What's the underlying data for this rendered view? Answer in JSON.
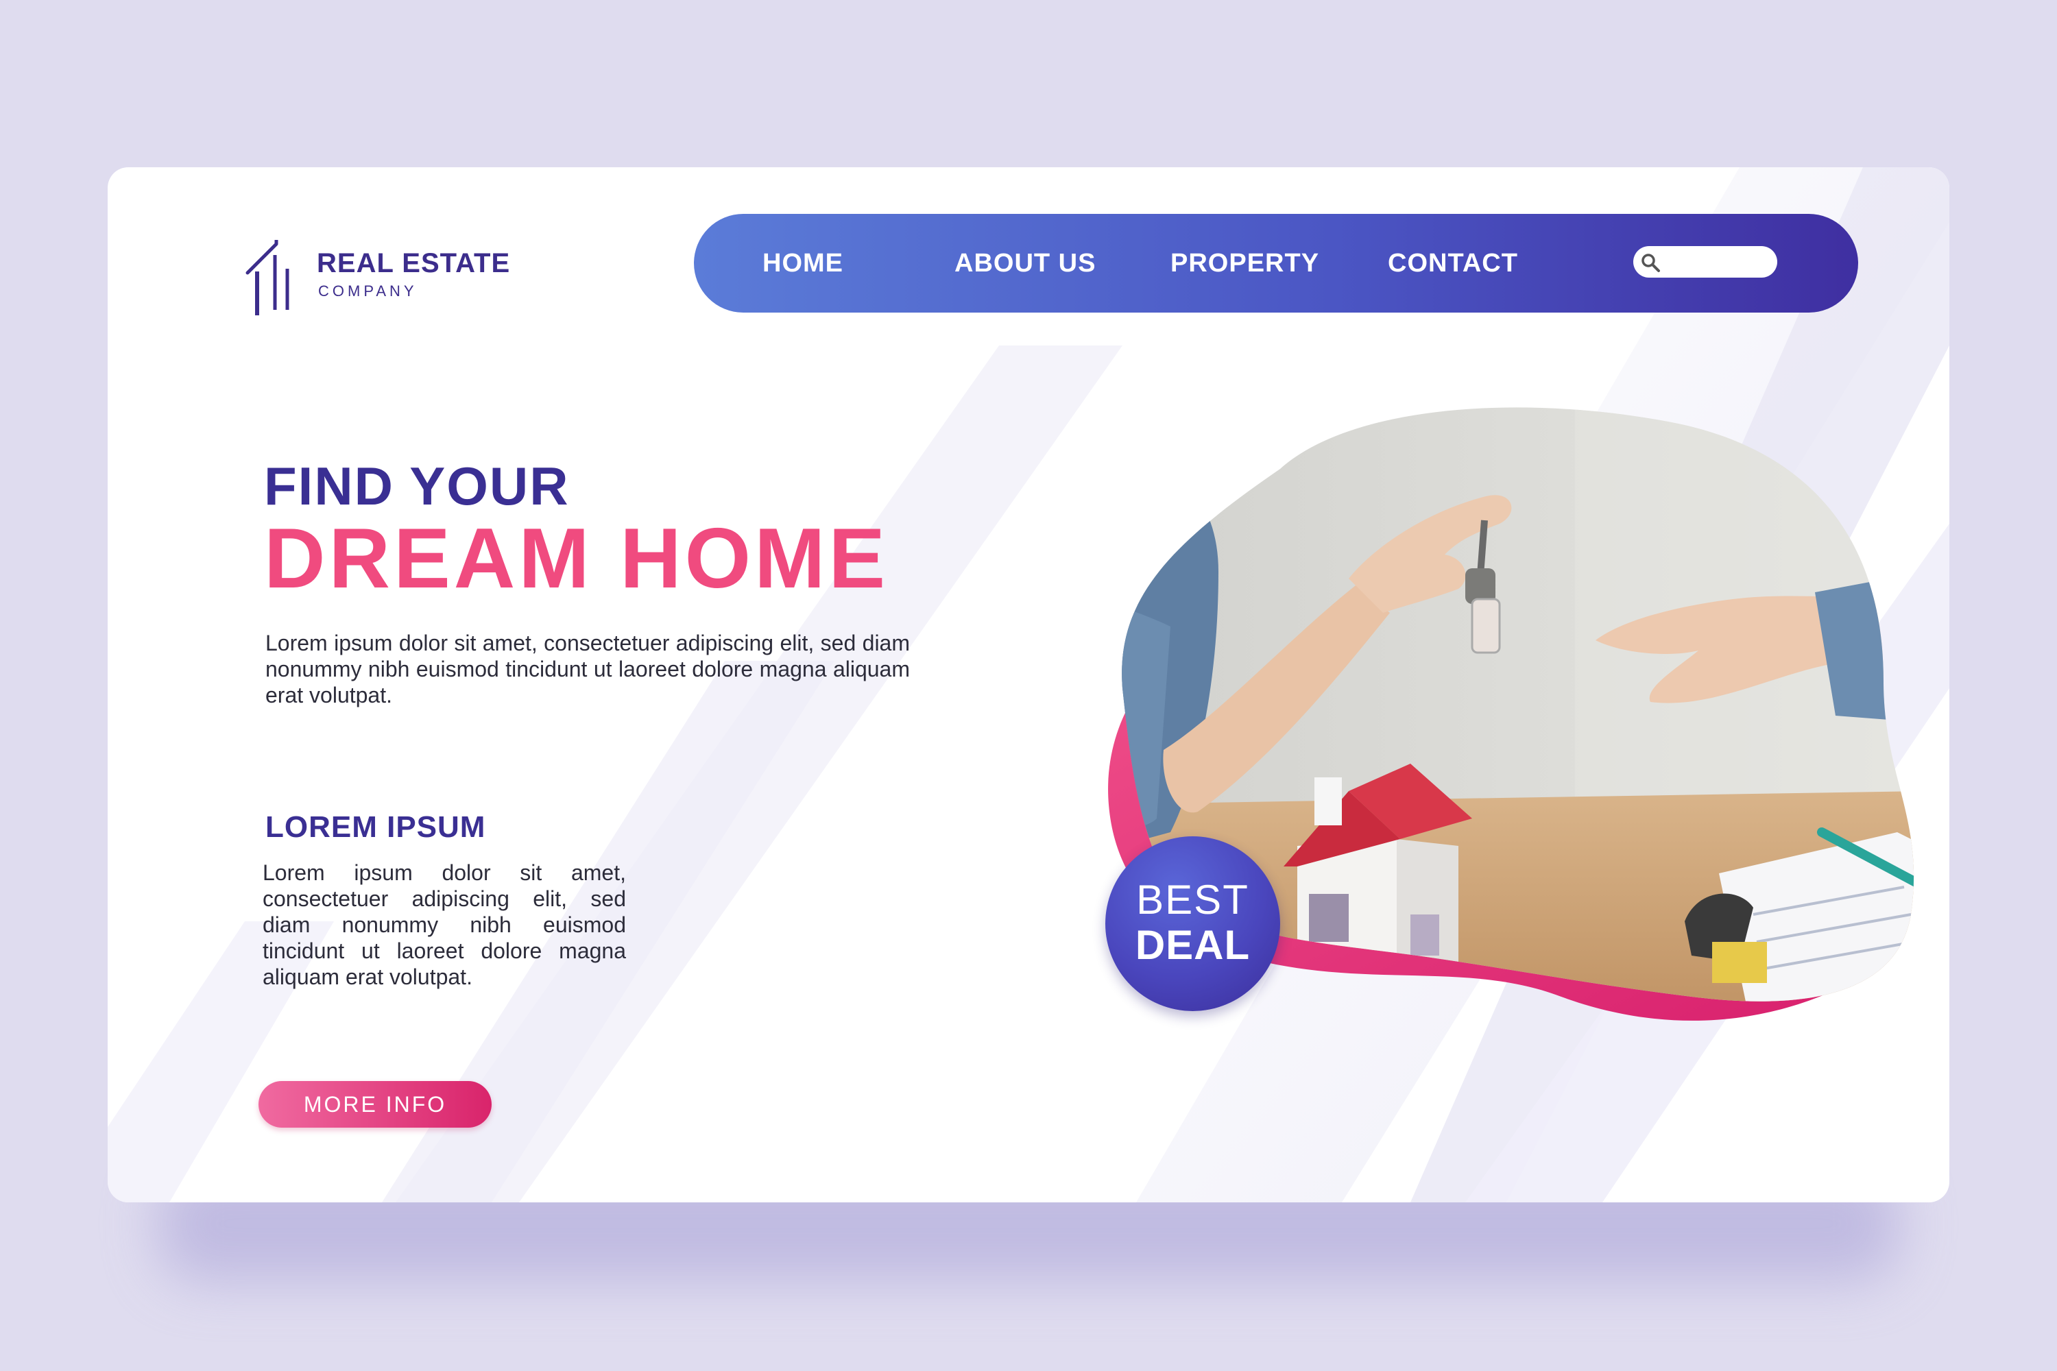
{
  "logo": {
    "title": "REAL ESTATE",
    "subtitle": "COMPANY",
    "icon": "house-lines-icon"
  },
  "nav": {
    "items": [
      {
        "label": "HOME"
      },
      {
        "label": "ABOUT US"
      },
      {
        "label": "PROPERTY"
      },
      {
        "label": "CONTACT"
      }
    ],
    "search": {
      "value": "",
      "placeholder": "",
      "icon": "search-icon"
    }
  },
  "hero": {
    "line1": "FIND YOUR",
    "line2": "DREAM HOME",
    "description": "Lorem ipsum dolor sit amet, consectetuer adipiscing elit, sed diam nonummy nibh euismod tincidunt ut laoreet dolore magna aliquam erat volutpat."
  },
  "section": {
    "title": "LOREM IPSUM",
    "text": "Lorem ipsum dolor sit amet, consectetuer adipiscing elit, sed diam nonummy nibh euismod tincidunt ut laoreet dolore magna aliquam erat volutpat."
  },
  "button": {
    "label": "MORE INFO"
  },
  "badge": {
    "top": "BEST",
    "bottom": "DEAL"
  },
  "colors": {
    "page_bg": "#dfdcef",
    "primary": "#3a2f93",
    "accent": "#f04b7f",
    "nav_start": "#5b7cd8",
    "nav_end": "#3f2fa1"
  }
}
